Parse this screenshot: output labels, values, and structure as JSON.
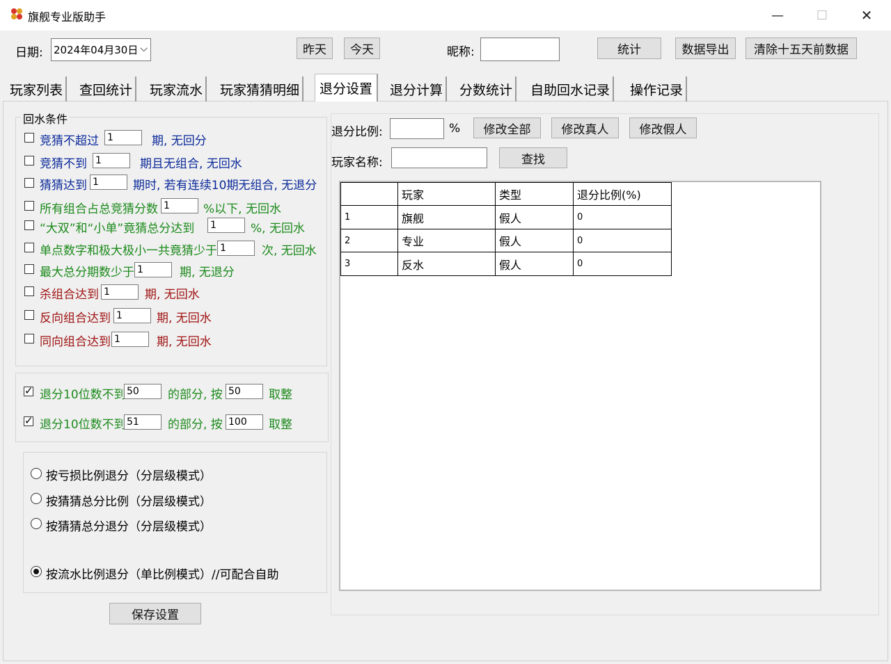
{
  "window": {
    "title": "旗舰专业版助手",
    "minimize_glyph": "—",
    "maximize_glyph": "☐",
    "close_glyph": "✕"
  },
  "toolbar": {
    "date_label": "日期:",
    "date_value": "2024年04月30日",
    "yesterday": "昨天",
    "today": "今天",
    "nickname_label": "昵称:",
    "nickname_value": "",
    "stats": "统计",
    "export": "数据导出",
    "clear": "清除十五天前数据"
  },
  "tabs": [
    {
      "label": "玩家列表"
    },
    {
      "label": "查回统计"
    },
    {
      "label": "玩家流水"
    },
    {
      "label": "玩家猜猜明细"
    },
    {
      "label": "退分设置",
      "active": true
    },
    {
      "label": "退分计算"
    },
    {
      "label": "分数统计"
    },
    {
      "label": "自助回水记录"
    },
    {
      "label": "操作记录"
    }
  ],
  "conditions": {
    "title": "回水条件",
    "rows": [
      {
        "prefix": "竞猜不超过",
        "value": "1",
        "suffix": "期, 无回分",
        "checked": false
      },
      {
        "prefix": "竞猜不到",
        "value": "1",
        "suffix": "期且无组合, 无回水",
        "checked": false
      },
      {
        "prefix": "猜猜达到",
        "value": "1",
        "suffix": "期时, 若有连续10期无组合, 无退分",
        "checked": false
      },
      {
        "prefix": "所有组合占总竞猜分数",
        "value": "1",
        "suffix": "%以下, 无回水",
        "checked": false
      },
      {
        "prefix": "“大双”和“小单”竟猜总分达到",
        "value": "1",
        "suffix": "%, 无回水",
        "checked": false
      },
      {
        "prefix": "单点数字和极大极小一共竟猜少于",
        "value": "1",
        "suffix": "次, 无回水",
        "checked": false
      },
      {
        "prefix": "最大总分期数少于",
        "value": "1",
        "suffix": "期, 无退分",
        "checked": false
      },
      {
        "prefix": "杀组合达到",
        "value": "1",
        "suffix": "期, 无回水",
        "checked": false
      },
      {
        "prefix": "反向组合达到",
        "value": "1",
        "suffix": "期, 无回水",
        "checked": false
      },
      {
        "prefix": "同向组合达到",
        "value": "1",
        "suffix": "期, 无回水",
        "checked": false
      }
    ]
  },
  "rounding": [
    {
      "prefix": "退分10位数不到",
      "value1": "50",
      "middle": "的部分, 按",
      "value2": "50",
      "suffix": "取整",
      "checked": true
    },
    {
      "prefix": "退分10位数不到",
      "value1": "51",
      "middle": "的部分, 按",
      "value2": "100",
      "suffix": "取整",
      "checked": true
    }
  ],
  "modes": [
    {
      "label": "按亏损比例退分（分层级模式）",
      "checked": false
    },
    {
      "label": "按猜猜总分比例（分层级模式）",
      "checked": false
    },
    {
      "label": "按猜猜总分退分（分层级模式）",
      "checked": false
    },
    {
      "label": "按流水比例退分（单比例模式）//可配合自助",
      "checked": true
    }
  ],
  "save_button": "保存设置",
  "right_panel": {
    "ratio_label": "退分比例:",
    "ratio_value": "",
    "percent": "%",
    "modify_all": "修改全部",
    "modify_real": "修改真人",
    "modify_fake": "修改假人",
    "player_name_label": "玩家名称:",
    "player_name_value": "",
    "find": "查找"
  },
  "table": {
    "headers": [
      "",
      "玩家",
      "类型",
      "退分比例(%)"
    ],
    "rows": [
      [
        "1",
        "旗舰",
        "假人",
        "0"
      ],
      [
        "2",
        "专业",
        "假人",
        "0"
      ],
      [
        "3",
        "反水",
        "假人",
        "0"
      ]
    ]
  }
}
